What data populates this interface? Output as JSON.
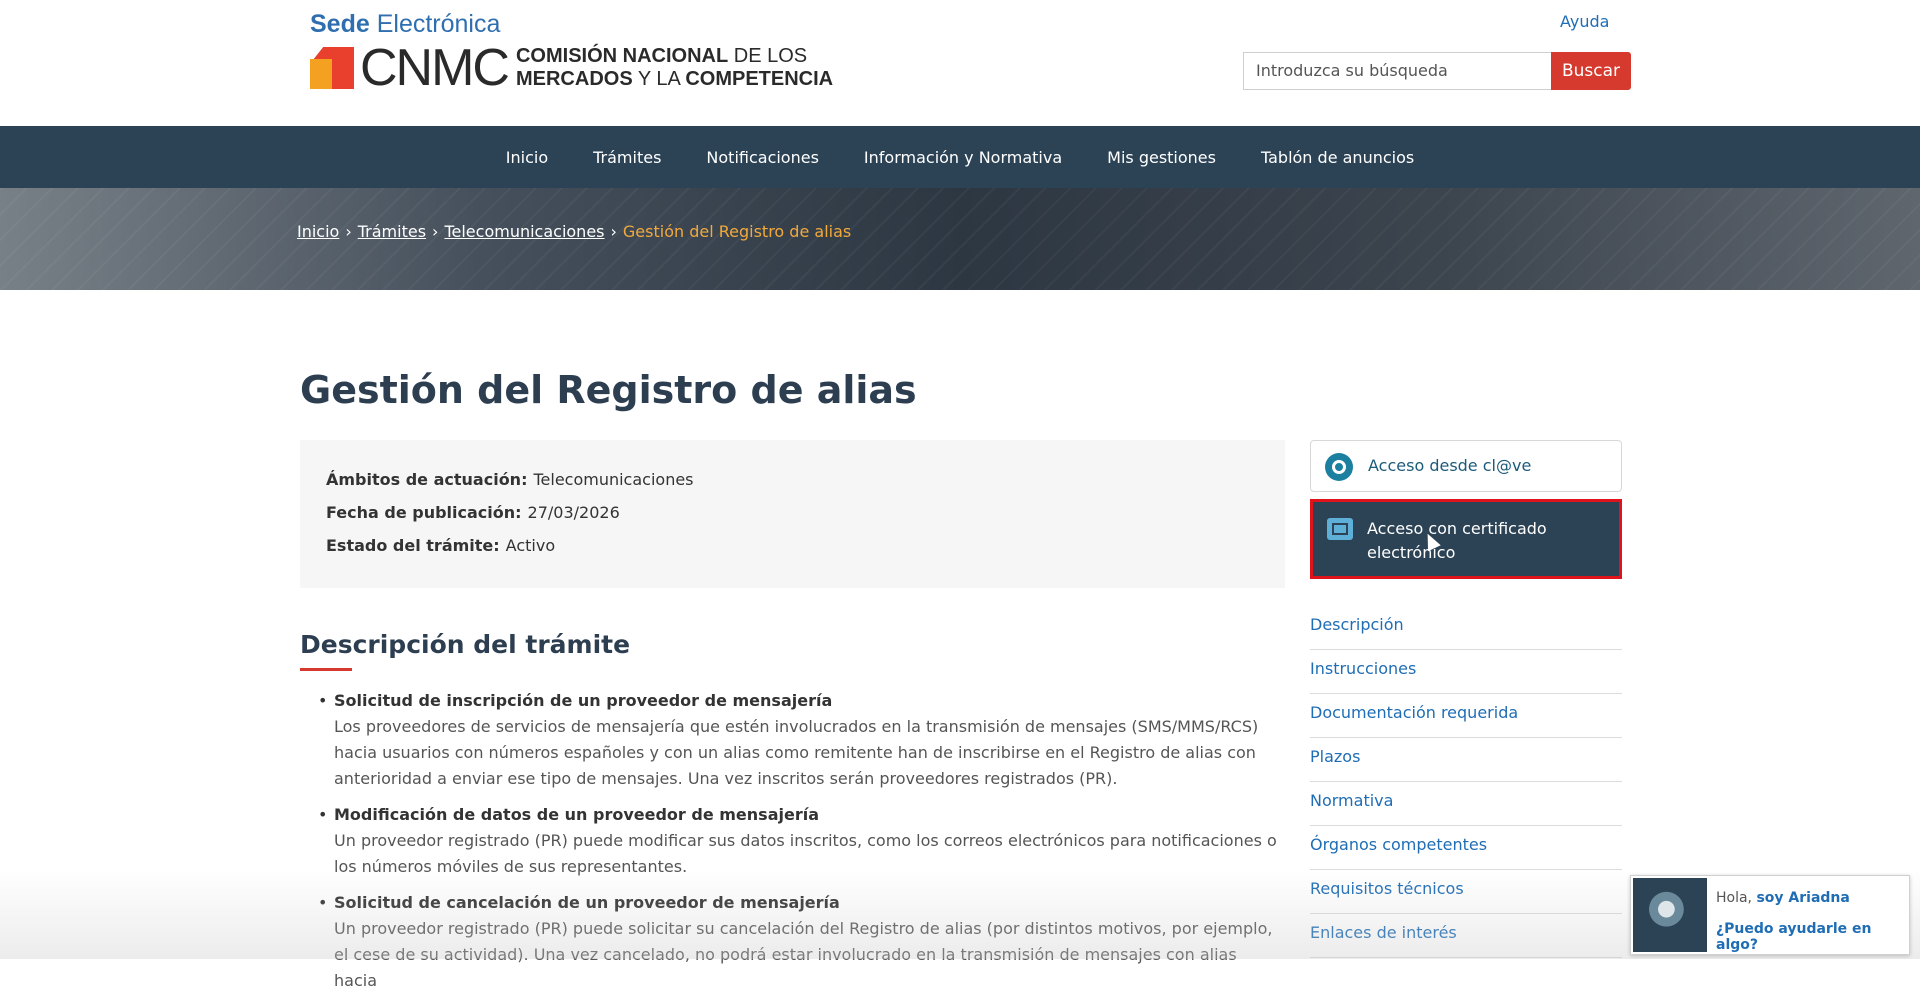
{
  "header": {
    "sede_bold": "Sede",
    "sede_rest": " Electrónica",
    "logo_acronym": "CNMC",
    "logo_line1_bold": "COMISIÓN NACIONAL",
    "logo_line1_rest": " DE LOS",
    "logo_line2_bold": "MERCADOS",
    "logo_line2_mid": " Y LA ",
    "logo_line2_end": "COMPETENCIA",
    "help_label": "Ayuda",
    "search_placeholder": "Introduzca su búsqueda",
    "search_button": "Buscar"
  },
  "nav": [
    "Inicio",
    "Trámites",
    "Notificaciones",
    "Información y Normativa",
    "Mis gestiones",
    "Tablón de anuncios"
  ],
  "breadcrumb": {
    "items": [
      "Inicio",
      "Trámites",
      "Telecomunicaciones"
    ],
    "current": "Gestión del Registro de alias",
    "separator": "›"
  },
  "page": {
    "title": "Gestión del Registro de alias",
    "info": [
      {
        "label": "Ámbitos de actuación:",
        "value": "Telecomunicaciones"
      },
      {
        "label": "Fecha de publicación:",
        "value": "27/03/2026"
      },
      {
        "label": "Estado del trámite:",
        "value": "Activo"
      }
    ],
    "section_title": "Descripción del trámite",
    "items": [
      {
        "title": "Solicitud de inscripción de un proveedor de mensajería",
        "text": "Los proveedores de servicios de mensajería que estén involucrados en la transmisión de mensajes (SMS/MMS/RCS) hacia usuarios con números españoles y con un alias como remitente han de inscribirse en el Registro de alias con anterioridad a enviar ese tipo de mensajes. Una vez inscritos serán proveedores registrados (PR)."
      },
      {
        "title": "Modificación de datos de un proveedor de mensajería",
        "text": "Un proveedor registrado (PR) puede modificar sus datos inscritos, como los correos electrónicos para notificaciones o los números móviles de sus representantes."
      },
      {
        "title": "Solicitud de cancelación de un proveedor de mensajería",
        "text": "Un proveedor registrado (PR) puede solicitar su cancelación del Registro de alias (por distintos motivos, por ejemplo, el cese de su actividad). Una vez cancelado, no podrá estar involucrado en la transmisión de mensajes con alias hacia"
      }
    ]
  },
  "sidebar": {
    "access_clave": "Acceso desde cl@ve",
    "access_cert": "Acceso con certificado electrónico",
    "links": [
      "Descripción",
      "Instrucciones",
      "Documentación requerida",
      "Plazos",
      "Normativa",
      "Órganos competentes",
      "Requisitos técnicos",
      "Enlaces de interés"
    ]
  },
  "chat": {
    "greeting": "Hola, ",
    "name": "soy Ariadna",
    "question": "¿Puedo ayudarle en algo?"
  },
  "colors": {
    "nav_bg": "#2c4356",
    "accent_red": "#d63a2e",
    "link_blue": "#1f6db5",
    "breadcrumb_current": "#f2a93b",
    "highlight_border": "#e0131b"
  }
}
